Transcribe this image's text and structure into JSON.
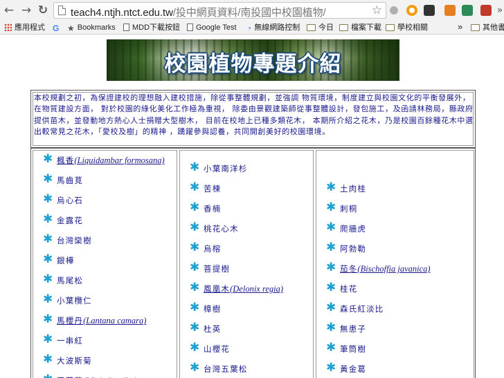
{
  "browser": {
    "back_glyph": "←",
    "forward_glyph": "→",
    "reload_glyph": "↻",
    "url_host": "teach4.ntjh.ntct.edu.tw",
    "url_path": "/投中網頁資料/南投國中校園植物/",
    "star_glyph": "☆",
    "more_glyph": "»",
    "extensions": [
      {
        "icon": "circle-icon",
        "color": "#b0b0b0"
      },
      {
        "icon": "orange-ring-icon",
        "color": "#f39c12"
      },
      {
        "icon": "film-icon",
        "color": "#333333"
      },
      {
        "icon": "download-arrow-icon",
        "color": "#e67e22"
      },
      {
        "icon": "green-badge-icon",
        "color": "#2e8b57"
      },
      {
        "icon": "pocket-icon",
        "color": "#c0392b"
      }
    ],
    "bookmarks": [
      {
        "label": "應用程式",
        "icon": "apps-grid-icon"
      },
      {
        "label": "",
        "icon": "google-icon"
      },
      {
        "label": "Bookmarks",
        "icon": "star-icon"
      },
      {
        "label": "MDD下載按鈕",
        "icon": "page-icon"
      },
      {
        "label": "Google Test",
        "icon": "page-icon"
      },
      {
        "label": "無線網路控制",
        "icon": "wifi-icon"
      },
      {
        "label": "今日",
        "icon": "folder-icon"
      },
      {
        "label": "檔案下載",
        "icon": "folder-icon"
      },
      {
        "label": "學校相關",
        "icon": "folder-icon"
      },
      {
        "label": "其他書",
        "icon": "folder-icon"
      }
    ]
  },
  "page": {
    "banner_title": "校園植物專題介紹",
    "intro": "本校規劃之初，為保證建校的理想融入建校措施，除從事整體規劃，並強調 物質環境，制度建立與校園文化的平衡發展外，在物質建設方面， 對於校園的綠化美化工作極為重視， 除委由景觀建築師從事整體設計，發包施工，及函請林務局，縣政府提供苗木，並發動地方熱心人士捐贈大型樹木， 目前在校地上已種多類花木， 本期所介紹之花木，乃是校園百餘種花木中選出較常見之花木，「愛校及樹」的精神 ，踴躍參與認養，共同開創美好的校園環境。",
    "bullet_glyph": "✱",
    "columns": [
      [
        {
          "name": "楓香",
          "latin": "(Liquidambar formosana)",
          "link": true
        },
        {
          "name": "馬齒莧",
          "latin": "",
          "link": false
        },
        {
          "name": "烏心石",
          "latin": "",
          "link": false
        },
        {
          "name": "金露花",
          "latin": "",
          "link": false
        },
        {
          "name": "台灣欒樹",
          "latin": "",
          "link": false
        },
        {
          "name": "銀樺",
          "latin": "",
          "link": false
        },
        {
          "name": "馬尾松",
          "latin": "",
          "link": false
        },
        {
          "name": "小葉欖仁",
          "latin": "",
          "link": false
        },
        {
          "name": "馬櫻丹",
          "latin": "(Lantana camara)",
          "link": true
        },
        {
          "name": "一串紅",
          "latin": "",
          "link": false
        },
        {
          "name": "大波斯菊",
          "latin": "",
          "link": false
        },
        {
          "name": "玉蘭花",
          "latin": "(Michelia alba)",
          "link": true
        }
      ],
      [
        {
          "name": "小葉南洋杉",
          "latin": "",
          "link": false
        },
        {
          "name": "苦楝",
          "latin": "",
          "link": false
        },
        {
          "name": "香楠",
          "latin": "",
          "link": false
        },
        {
          "name": "桃花心木",
          "latin": "",
          "link": false
        },
        {
          "name": "烏榕",
          "latin": "",
          "link": false
        },
        {
          "name": "菩提樹",
          "latin": "",
          "link": false
        },
        {
          "name": "鳳凰木",
          "latin": "(Delonix regia)",
          "link": true
        },
        {
          "name": "樟樹",
          "latin": "",
          "link": false
        },
        {
          "name": "杜英",
          "latin": "",
          "link": false
        },
        {
          "name": "山櫻花",
          "latin": "",
          "link": false
        },
        {
          "name": "台灣五葉松",
          "latin": "",
          "link": false
        }
      ],
      [
        {
          "name": "土肉桂",
          "latin": "",
          "link": false
        },
        {
          "name": "刺桐",
          "latin": "",
          "link": false
        },
        {
          "name": "爬牆虎",
          "latin": "",
          "link": false
        },
        {
          "name": "阿勃勒",
          "latin": "",
          "link": false
        },
        {
          "name": "茄冬",
          "latin": "(Bischoffia javanica)",
          "link": true
        },
        {
          "name": "桂花",
          "latin": "",
          "link": false
        },
        {
          "name": "森氏紅淡比",
          "latin": "",
          "link": false
        },
        {
          "name": "無患子",
          "latin": "",
          "link": false
        },
        {
          "name": "筆筒樹",
          "latin": "",
          "link": false
        },
        {
          "name": "黃金葛",
          "latin": "",
          "link": false
        }
      ]
    ]
  }
}
